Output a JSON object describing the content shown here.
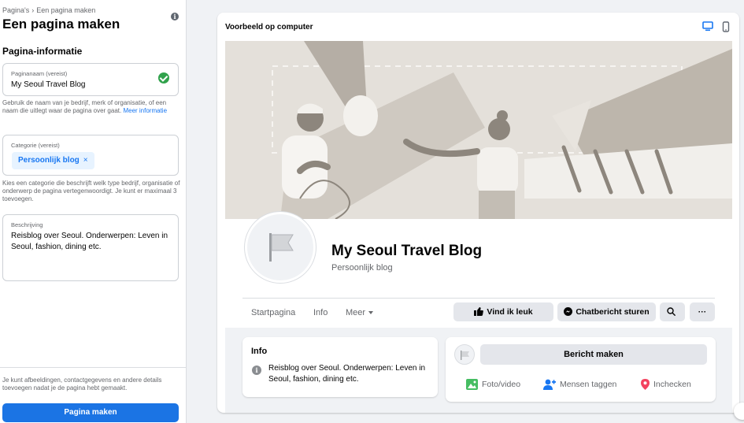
{
  "left_panel": {
    "breadcrumb": [
      "Pagina's",
      "Een pagina maken"
    ],
    "breadcrumb_sep": "›",
    "info_glyph": "i",
    "title": "Een pagina maken",
    "section_title": "Pagina-informatie",
    "page_name_field": {
      "label": "Paginanaam (vereist)",
      "value": "My Seoul Travel Blog",
      "status_icon": "check-circle-icon"
    },
    "page_name_help": "Gebruik de naam van je bedrijf, merk of organisatie, of een naam die uitlegt waar de pagina over gaat.",
    "page_name_help_link": "Meer informatie",
    "category_field": {
      "label": "Categorie (vereist)",
      "chip": "Persoonlijk blog",
      "chip_remove": "×"
    },
    "category_help": "Kies een categorie die beschrijft welk type bedrijf, organisatie of onderwerp de pagina vertegenwoordigt. Je kunt er maximaal 3 toevoegen.",
    "description_field": {
      "label": "Beschrijving",
      "value": "Reisblog over Seoul. Onderwerpen: Leven in Seoul, fashion, dining etc."
    },
    "footer_note": "Je kunt afbeeldingen, contactgegevens en andere details toevoegen nadat je de pagina hebt gemaakt.",
    "create_button": "Pagina maken"
  },
  "preview": {
    "title": "Voorbeeld op computer",
    "device_icons": [
      "desktop-icon",
      "mobile-icon"
    ],
    "page_name": "My Seoul Travel Blog",
    "page_category": "Persoonlijk blog",
    "tabs": [
      "Startpagina",
      "Info",
      "Meer"
    ],
    "like_button": "Vind ik leuk",
    "message_button": "Chatbericht sturen",
    "more_glyph": "···",
    "info_card": {
      "title": "Info",
      "glyph": "i",
      "text": "Reisblog over Seoul. Onderwerpen: Leven in Seoul, fashion, dining etc."
    },
    "post_card": {
      "compose_button": "Bericht maken",
      "actions": [
        "Foto/video",
        "Mensen taggen",
        "Inchecken"
      ]
    }
  },
  "colors": {
    "primary": "#1b74e4",
    "link": "#1877f2",
    "success": "#31a24c",
    "photo_green": "#45bd62",
    "tag_blue": "#1877f2",
    "checkin_red": "#f3425f"
  }
}
